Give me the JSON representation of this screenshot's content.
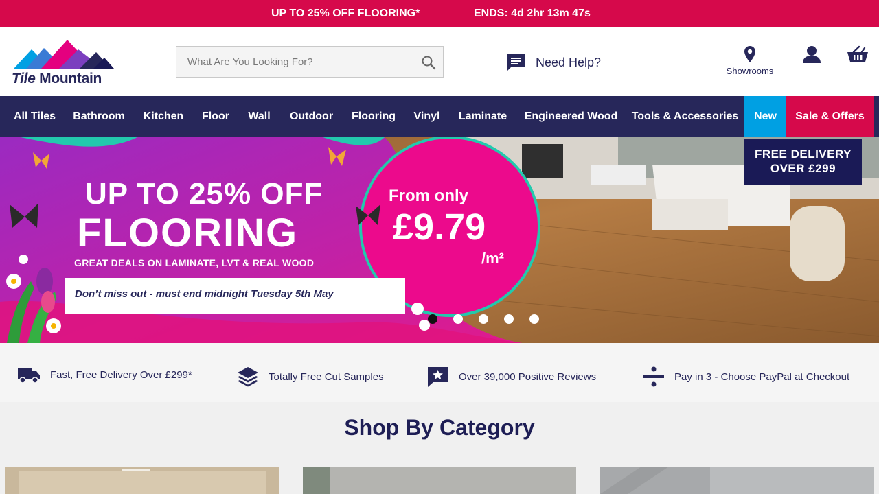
{
  "promo": {
    "text": "UP TO 25% OFF FLOORING*",
    "countdown": "ENDS: 4d 2hr 13m 47s"
  },
  "header": {
    "logo_text_1": "Tile",
    "logo_text_2": "Mountain",
    "search_placeholder": "What Are You Looking For?",
    "help_label": "Need Help?",
    "showrooms_label": "Showrooms"
  },
  "nav": {
    "items": [
      "All Tiles",
      "Bathroom",
      "Kitchen",
      "Floor",
      "Wall",
      "Outdoor",
      "Flooring",
      "Vinyl",
      "Laminate",
      "Engineered Wood",
      "Tools & Accessories",
      "New",
      "Sale & Offers"
    ]
  },
  "hero": {
    "line1": "UP TO 25% OFF",
    "line2": "FLOORING",
    "line3": "GREAT DEALS ON LAMINATE, LVT & REAL WOOD",
    "line4": "Don’t miss out - must end midnight Tuesday 5th May",
    "price_from": "From only",
    "price_value": "£9.79",
    "price_unit": "/m²",
    "delivery_line1": "FREE DELIVERY",
    "delivery_line2": "OVER £299",
    "active_slide": 1,
    "slide_count": 5
  },
  "usps": [
    {
      "icon": "truck-icon",
      "text": "Fast, Free Delivery Over £299*"
    },
    {
      "icon": "layers-icon",
      "text": "Totally Free Cut Samples"
    },
    {
      "icon": "star-review-icon",
      "text": "Over 39,000 Positive Reviews"
    },
    {
      "icon": "divide-icon",
      "text": "Pay in 3 - Choose PayPal at Checkout"
    }
  ],
  "category": {
    "title": "Shop By Category"
  },
  "colors": {
    "brand_navy": "#27275a",
    "brand_pink": "#d6094b",
    "new_blue": "#00a0e3"
  }
}
